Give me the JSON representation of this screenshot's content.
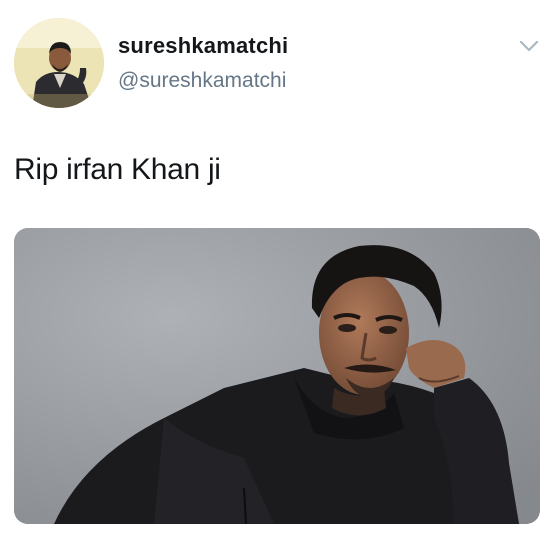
{
  "user": {
    "display_name": "sureshkamatchi",
    "handle": "@sureshkamatchi"
  },
  "tweet": {
    "text": "Rip irfan Khan ji"
  },
  "icons": {
    "menu": "chevron-down-icon"
  },
  "colors": {
    "name": "#14171a",
    "handle": "#657786",
    "chevron": "#aab8c2",
    "photo_background": "#939599"
  }
}
